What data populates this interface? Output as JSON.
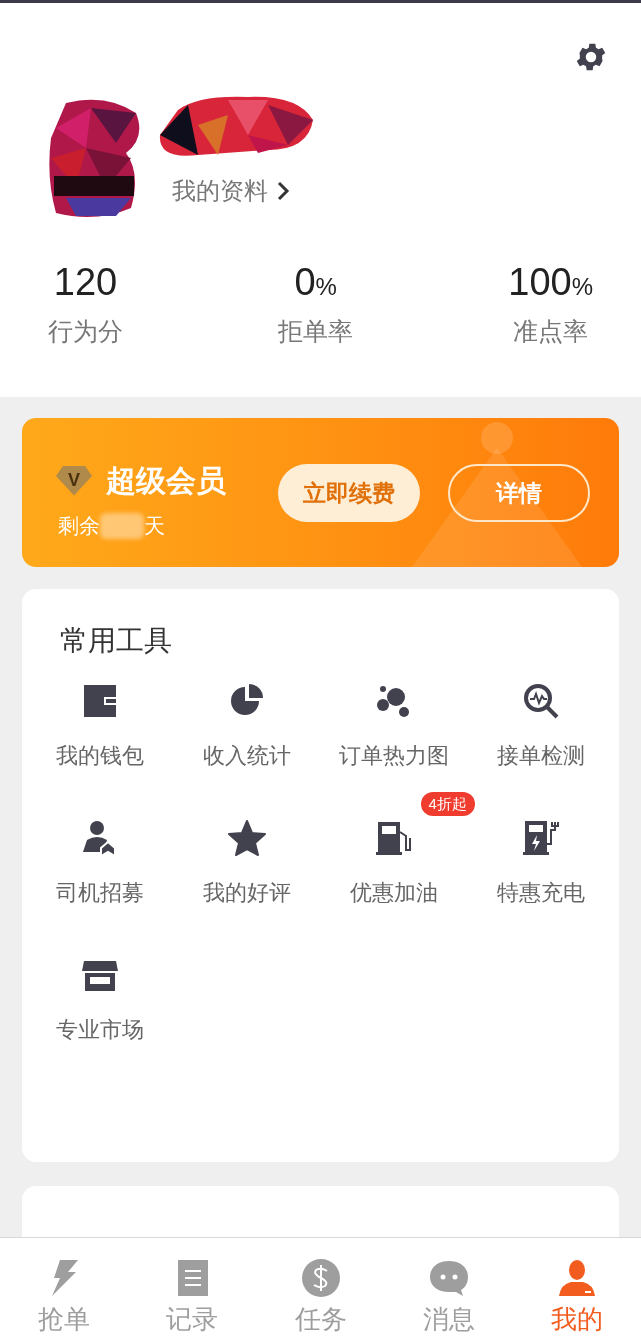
{
  "profile": {
    "link": "我的资料"
  },
  "stats": [
    {
      "value": "120",
      "label": "行为分"
    },
    {
      "value": "0",
      "unit": "%",
      "label": "拒单率"
    },
    {
      "value": "100",
      "unit": "%",
      "label": "准点率"
    }
  ],
  "vip": {
    "badge": "V",
    "title": "超级会员",
    "remaining_prefix": "剩余",
    "remaining_suffix": "天",
    "renew_button": "立即续费",
    "details_button": "详情"
  },
  "tools": {
    "title": "常用工具",
    "items": [
      {
        "label": "我的钱包"
      },
      {
        "label": "收入统计"
      },
      {
        "label": "订单热力图"
      },
      {
        "label": "接单检测"
      },
      {
        "label": "司机招募"
      },
      {
        "label": "我的好评"
      },
      {
        "label": "优惠加油",
        "badge": "4折起"
      },
      {
        "label": "特惠充电"
      },
      {
        "label": "专业市场"
      }
    ]
  },
  "tab_bar": [
    {
      "label": "抢单",
      "selected": false
    },
    {
      "label": "记录",
      "selected": false
    },
    {
      "label": "任务",
      "selected": false
    },
    {
      "label": "消息",
      "selected": false
    },
    {
      "label": "我的",
      "selected": true
    }
  ]
}
